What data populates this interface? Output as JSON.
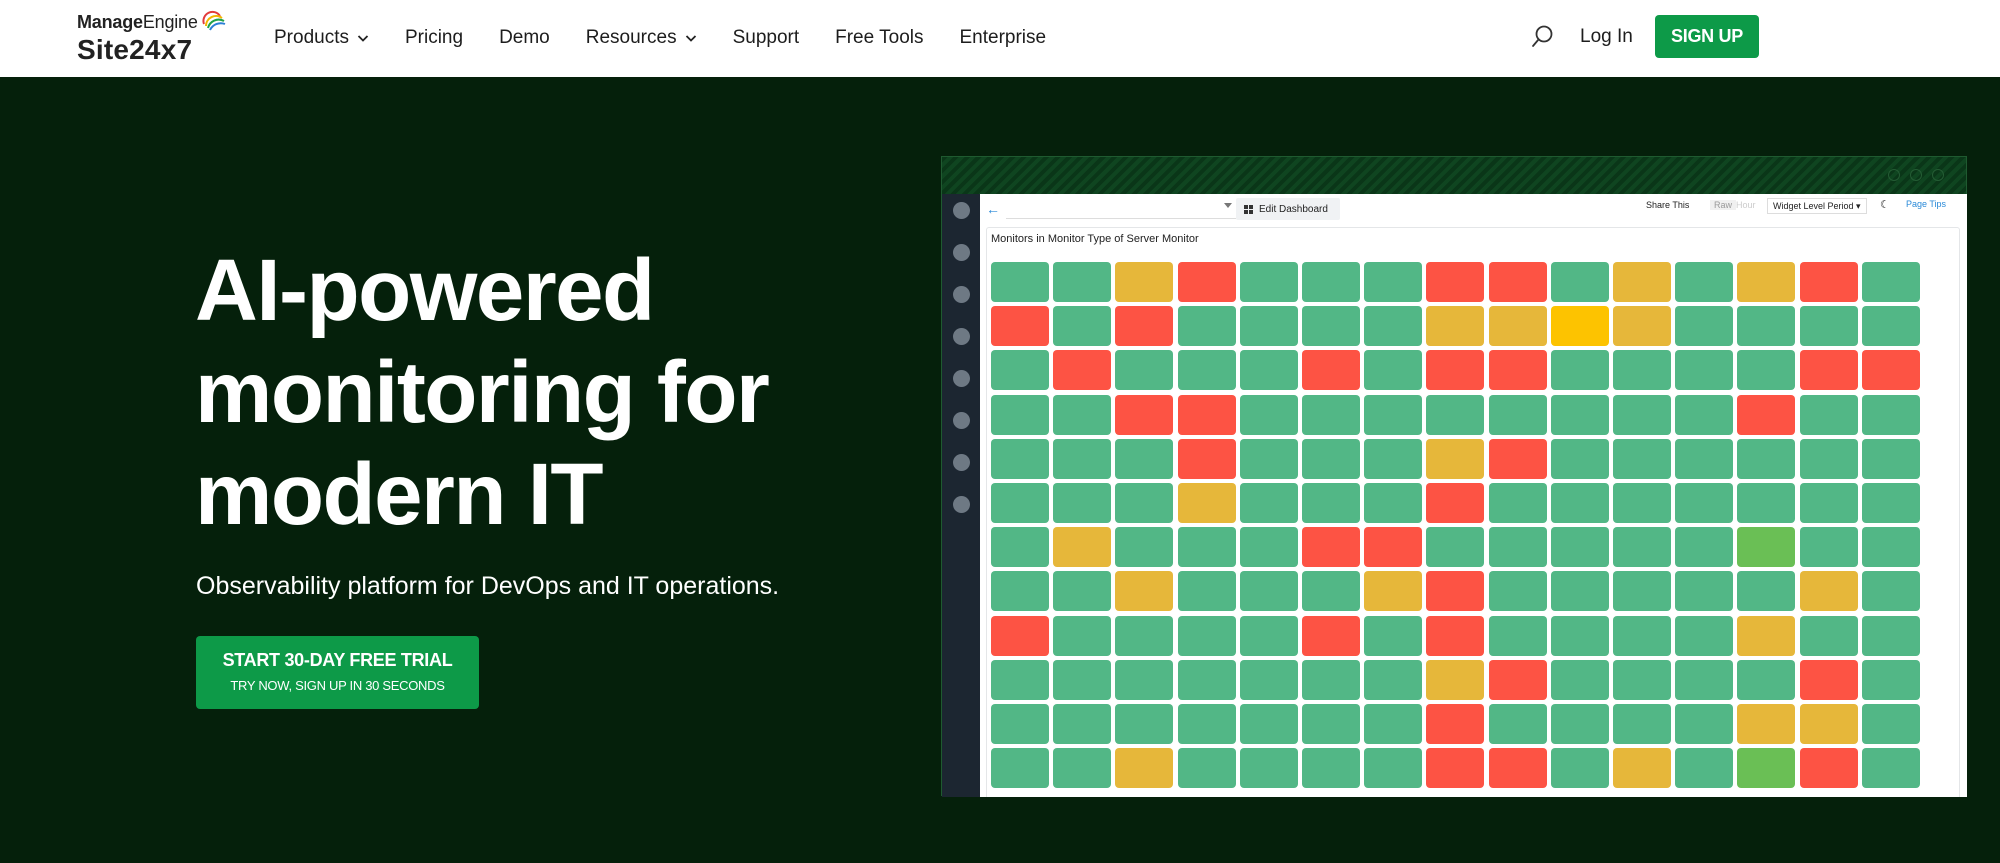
{
  "nav": {
    "brand_top_bold": "Manage",
    "brand_top_light": "Engine",
    "brand_product": "Site24x7",
    "menu": [
      {
        "label": "Products",
        "has_dropdown": true
      },
      {
        "label": "Pricing",
        "has_dropdown": false
      },
      {
        "label": "Demo",
        "has_dropdown": false
      },
      {
        "label": "Resources",
        "has_dropdown": true
      },
      {
        "label": "Support",
        "has_dropdown": false
      },
      {
        "label": "Free Tools",
        "has_dropdown": false
      },
      {
        "label": "Enterprise",
        "has_dropdown": false
      }
    ],
    "login_label": "Log In",
    "signup_label": "SIGN UP"
  },
  "hero": {
    "title_lines": [
      "AI-powered",
      "monitoring for",
      "modern IT"
    ],
    "subtitle": "Observability platform for DevOps and IT operations.",
    "cta_main": "START 30-DAY FREE TRIAL",
    "cta_sub": "TRY NOW, SIGN UP IN 30 SECONDS"
  },
  "dashboard": {
    "edit_label": "Edit Dashboard",
    "share_label": "Share This",
    "raw_label": "Raw",
    "hour_label": "Hour",
    "period_label": "Widget Level Period",
    "tips_label": "Page Tips",
    "widget_title": "Monitors in Monitor Type of Server Monitor",
    "status_colors": {
      "G": "#52b786",
      "R": "#fd5344",
      "Y": "#e6b73a",
      "O": "#fdc300",
      "L": "#6abf55"
    },
    "status_grid": [
      "GGYRGGGRRGYGYRG",
      "RGRGGGGYYOYGGGG",
      "GRGGGRGRRGGGGRR",
      "GGRRGGGGGGGGRGG",
      "GGGRGGGYRGGGGGG",
      "GGGYGGGRGGGGGGG",
      "GYGGGRRGGGGGLGG",
      "GGYGGGYRGGGGGYG",
      "RGGGGRGRGGGGYGG",
      "GGGGGGGYRGGGGRG",
      "GGGGGGGRGGGGYYG",
      "GGYGGGGRRGYGLRG"
    ]
  }
}
